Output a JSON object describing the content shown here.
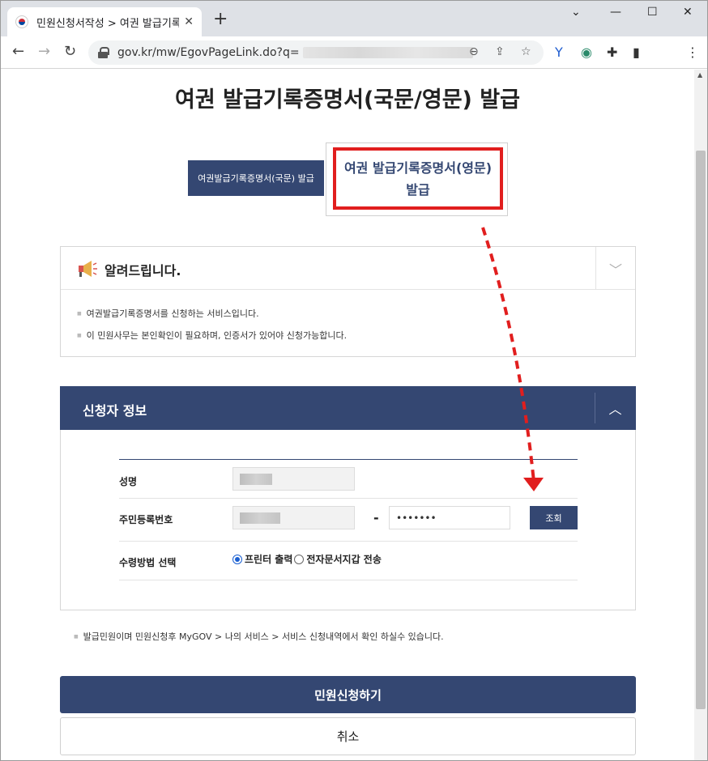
{
  "browser": {
    "tab_title": "민원신청서작성 > 여권 발급기록",
    "url": "gov.kr/mw/EgovPageLink.do?q="
  },
  "page": {
    "title": "여권 발급기록증명서(국문/영문) 발급",
    "tabs": {
      "korean_label": "여권발급기록증명서(국문) 발급",
      "english_label": "여권 발급기록증명서(영문) 발급"
    },
    "notice": {
      "title": "알려드립니다.",
      "items": [
        "여권발급기록증명서를 신청하는 서비스입니다.",
        "이 민원사무는 본인확인이 필요하며, 인증서가 있어야 신청가능합니다."
      ]
    },
    "applicant": {
      "title": "신청자 정보",
      "name_label": "성명",
      "rrn_label": "주민등록번호",
      "rrn_dash": "-",
      "rrn_back_masked": "•••••••",
      "lookup_button": "조회",
      "receive_label": "수령방법 선택",
      "receive_options": [
        "프린터 출력",
        "전자문서지갑 전송"
      ],
      "receive_selected": "프린터 출력"
    },
    "footnote": "발급민원이며 민원신청후 MyGOV > 나의 서비스 > 서비스 신청내역에서 확인 하실수 있습니다.",
    "submit_button": "민원신청하기",
    "cancel_button": "취소"
  },
  "colors": {
    "primary_navy": "#344772",
    "highlight_red": "#e11e1e"
  }
}
